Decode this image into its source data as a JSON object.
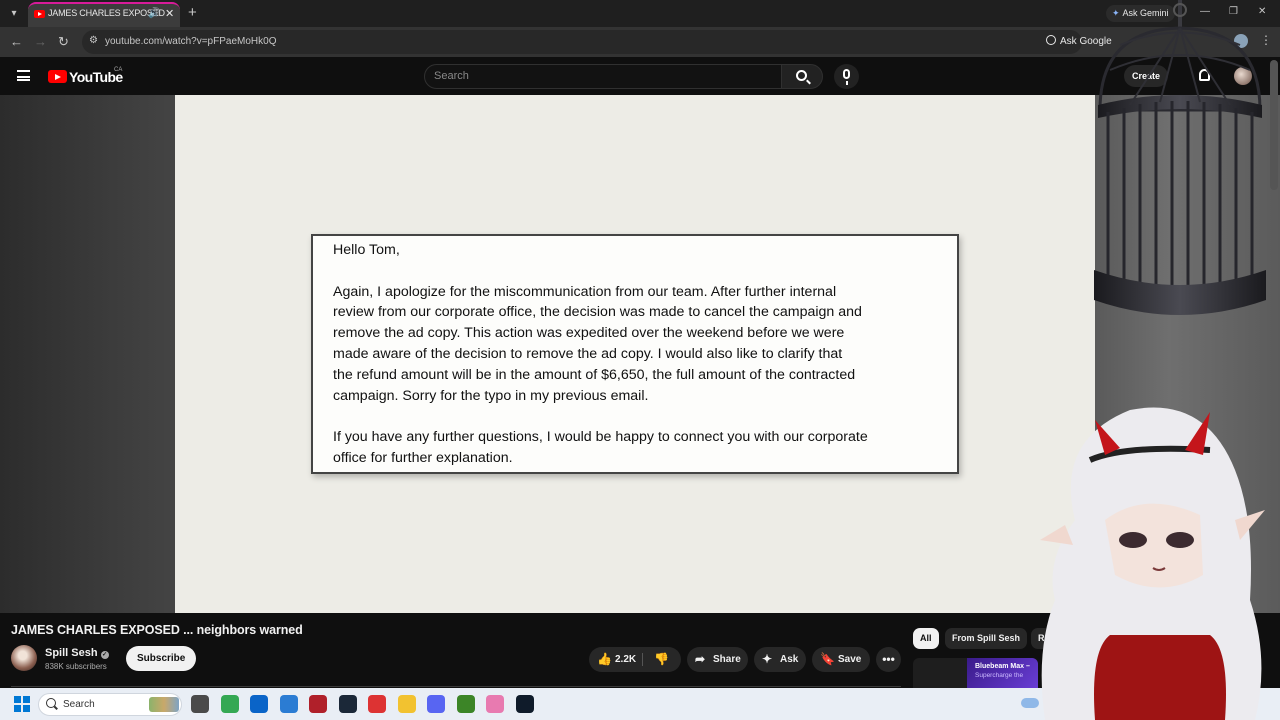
{
  "browser": {
    "tab_title": "JAMES CHARLES EXPOSED",
    "new_tab_symbol": "+",
    "gemini_label": "Ask Gemini",
    "url": "youtube.com/watch?v=pFPaeMoHk0Q",
    "ask_google_label": "Ask Google"
  },
  "youtube": {
    "logo_text": "YouTube",
    "region": "CA",
    "search_placeholder": "Search",
    "create_label": "Create"
  },
  "letter": {
    "greeting": "Hello Tom,",
    "paragraph1_lines": [
      "Again, I apologize for the miscommunication from our team.  After further internal",
      "review from our corporate office, the decision was made to cancel the campaign and",
      "remove the ad copy.  This action was expedited over the weekend before we were",
      "made aware of the decision to remove the ad copy.  I would also like to clarify that",
      "the refund amount will be in the amount of $6,650, the full amount of the contracted",
      "campaign.  Sorry for the typo in my previous email."
    ],
    "paragraph2_lines": [
      "If you have any further questions, I would be happy to connect you with our corporate",
      "office for further explanation."
    ]
  },
  "video": {
    "title": "JAMES CHARLES EXPOSED ... neighbors warned",
    "channel_name": "Spill Sesh",
    "subscribers": "838K subscribers",
    "subscribe_label": "Subscribe",
    "likes": "2.2K",
    "share_label": "Share",
    "ask_label": "Ask",
    "save_label": "Save",
    "more_label": "•••"
  },
  "recommendations": {
    "chips": [
      "All",
      "From Spill Sesh",
      "Re"
    ],
    "ad_title": "Bluebeam Max –",
    "ad_subtitle": "Supercharge the"
  },
  "taskbar": {
    "search_placeholder": "Search",
    "apps": [
      {
        "name": "file-manager-icon",
        "color": "#4a4a4a"
      },
      {
        "name": "chrome-icon",
        "color": "#34a853"
      },
      {
        "name": "outlook-icon",
        "color": "#0a64c8"
      },
      {
        "name": "store-icon",
        "color": "#2b7cd3"
      },
      {
        "name": "vivaldi-icon",
        "color": "#b0202a"
      },
      {
        "name": "steam-icon",
        "color": "#1b2838"
      },
      {
        "name": "pokeball-icon",
        "color": "#d33"
      },
      {
        "name": "folder-icon",
        "color": "#f2c230"
      },
      {
        "name": "discord-icon",
        "color": "#5865f2"
      },
      {
        "name": "minecraft-icon",
        "color": "#3c8527"
      },
      {
        "name": "heart-app-icon",
        "color": "#e87ab0"
      },
      {
        "name": "steam-icon",
        "color": "#0f1b2a"
      }
    ]
  },
  "colors": {
    "accent_red": "#ff0000",
    "tab_accent": "#d81b9a",
    "page_bg": "#0f0f0f"
  }
}
